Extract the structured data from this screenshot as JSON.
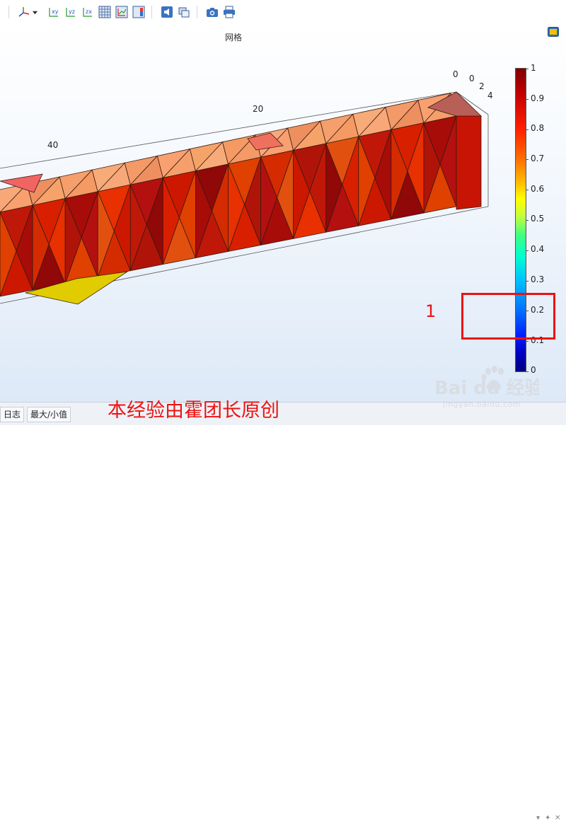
{
  "toolbar": {
    "icons": [
      "axis-orientation-icon",
      "dropdown-arrow-icon",
      "xy-plane-icon",
      "yz-plane-icon",
      "zx-plane-icon",
      "grid-icon",
      "axis-icon",
      "colorbar-icon",
      "lighting-icon",
      "transparency-icon",
      "camera-icon",
      "print-icon"
    ],
    "labels": {
      "xy": "xy",
      "yz": "yz",
      "zx": "zx"
    }
  },
  "plot": {
    "title": "网格",
    "axis_labels": {
      "a40": "40",
      "a20": "20",
      "a0_top": "0",
      "a0": "0",
      "a2": "2",
      "a4": "4"
    }
  },
  "colorbar": {
    "ticks": [
      "1",
      "0.9",
      "0.8",
      "0.7",
      "0.6",
      "0.5",
      "0.4",
      "0.3",
      "0.2",
      "0.1",
      "0"
    ],
    "colors": {
      "top": "#7f0000",
      "bottom": "#00007f"
    }
  },
  "annotation": {
    "number": "1",
    "color": "#ee1111"
  },
  "bottom": {
    "tabs": [
      "日志",
      "最大/小值"
    ],
    "watermark": "本经验由霍团长原创",
    "logo_text": "Bai du 经验",
    "logo_url": "jingyan.baidu.com"
  }
}
